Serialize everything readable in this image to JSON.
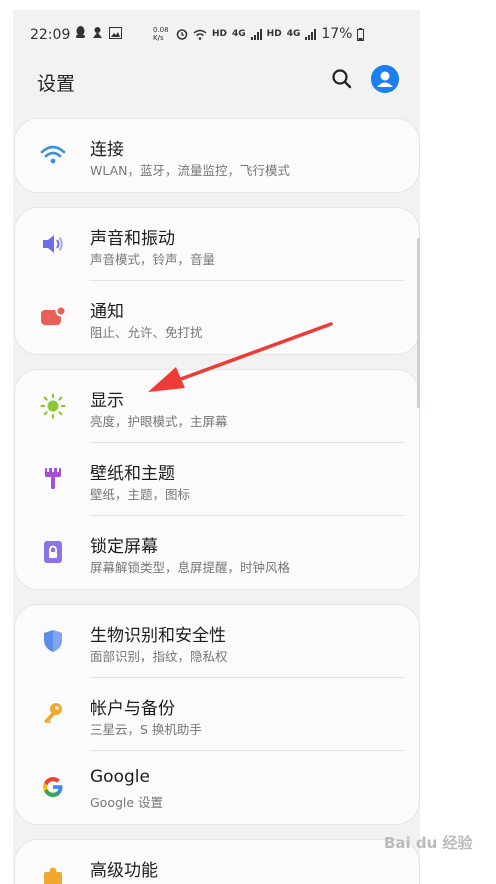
{
  "status_bar": {
    "time": "22:09",
    "net_speed": "0.08 K/s",
    "network_labels": [
      "HD",
      "4G",
      "HD",
      "4G"
    ],
    "battery": "17%"
  },
  "header": {
    "title": "设置"
  },
  "sections": [
    {
      "items": [
        {
          "name": "connections",
          "title": "连接",
          "subtitle": "WLAN，蓝牙，流量监控，飞行模式",
          "icon": "wifi-icon",
          "color": "#3d8fe0"
        }
      ]
    },
    {
      "items": [
        {
          "name": "sound",
          "title": "声音和振动",
          "subtitle": "声音模式，铃声，音量",
          "icon": "volume-icon",
          "color": "#6e6ee8"
        },
        {
          "name": "notifications",
          "title": "通知",
          "subtitle": "阻止、允许、免打扰",
          "icon": "notification-icon",
          "color": "#e8605a"
        }
      ]
    },
    {
      "items": [
        {
          "name": "display",
          "title": "显示",
          "subtitle": "亮度，护眼模式，主屏幕",
          "icon": "brightness-icon",
          "color": "#8cc832"
        },
        {
          "name": "wallpaper",
          "title": "壁纸和主题",
          "subtitle": "壁纸，主题，图标",
          "icon": "brush-icon",
          "color": "#a54fd3"
        },
        {
          "name": "lockscreen",
          "title": "锁定屏幕",
          "subtitle": "屏幕解锁类型，息屏提醒，时钟风格",
          "icon": "lock-icon",
          "color": "#8d73e8"
        }
      ]
    },
    {
      "items": [
        {
          "name": "biometrics",
          "title": "生物识别和安全性",
          "subtitle": "面部识别，指纹，隐私权",
          "icon": "shield-icon",
          "color": "#5b8de8"
        },
        {
          "name": "accounts",
          "title": "帐户与备份",
          "subtitle": "三星云，S 换机助手",
          "icon": "key-icon",
          "color": "#f0a830"
        },
        {
          "name": "google",
          "title": "Google",
          "subtitle": "Google 设置",
          "icon": "google-icon",
          "color": "#4285f4"
        }
      ]
    },
    {
      "items": [
        {
          "name": "advanced",
          "title": "高级功能",
          "subtitle": "",
          "icon": "puzzle-icon",
          "color": "#f0a830"
        }
      ]
    }
  ],
  "watermark": "Bai du 经验"
}
